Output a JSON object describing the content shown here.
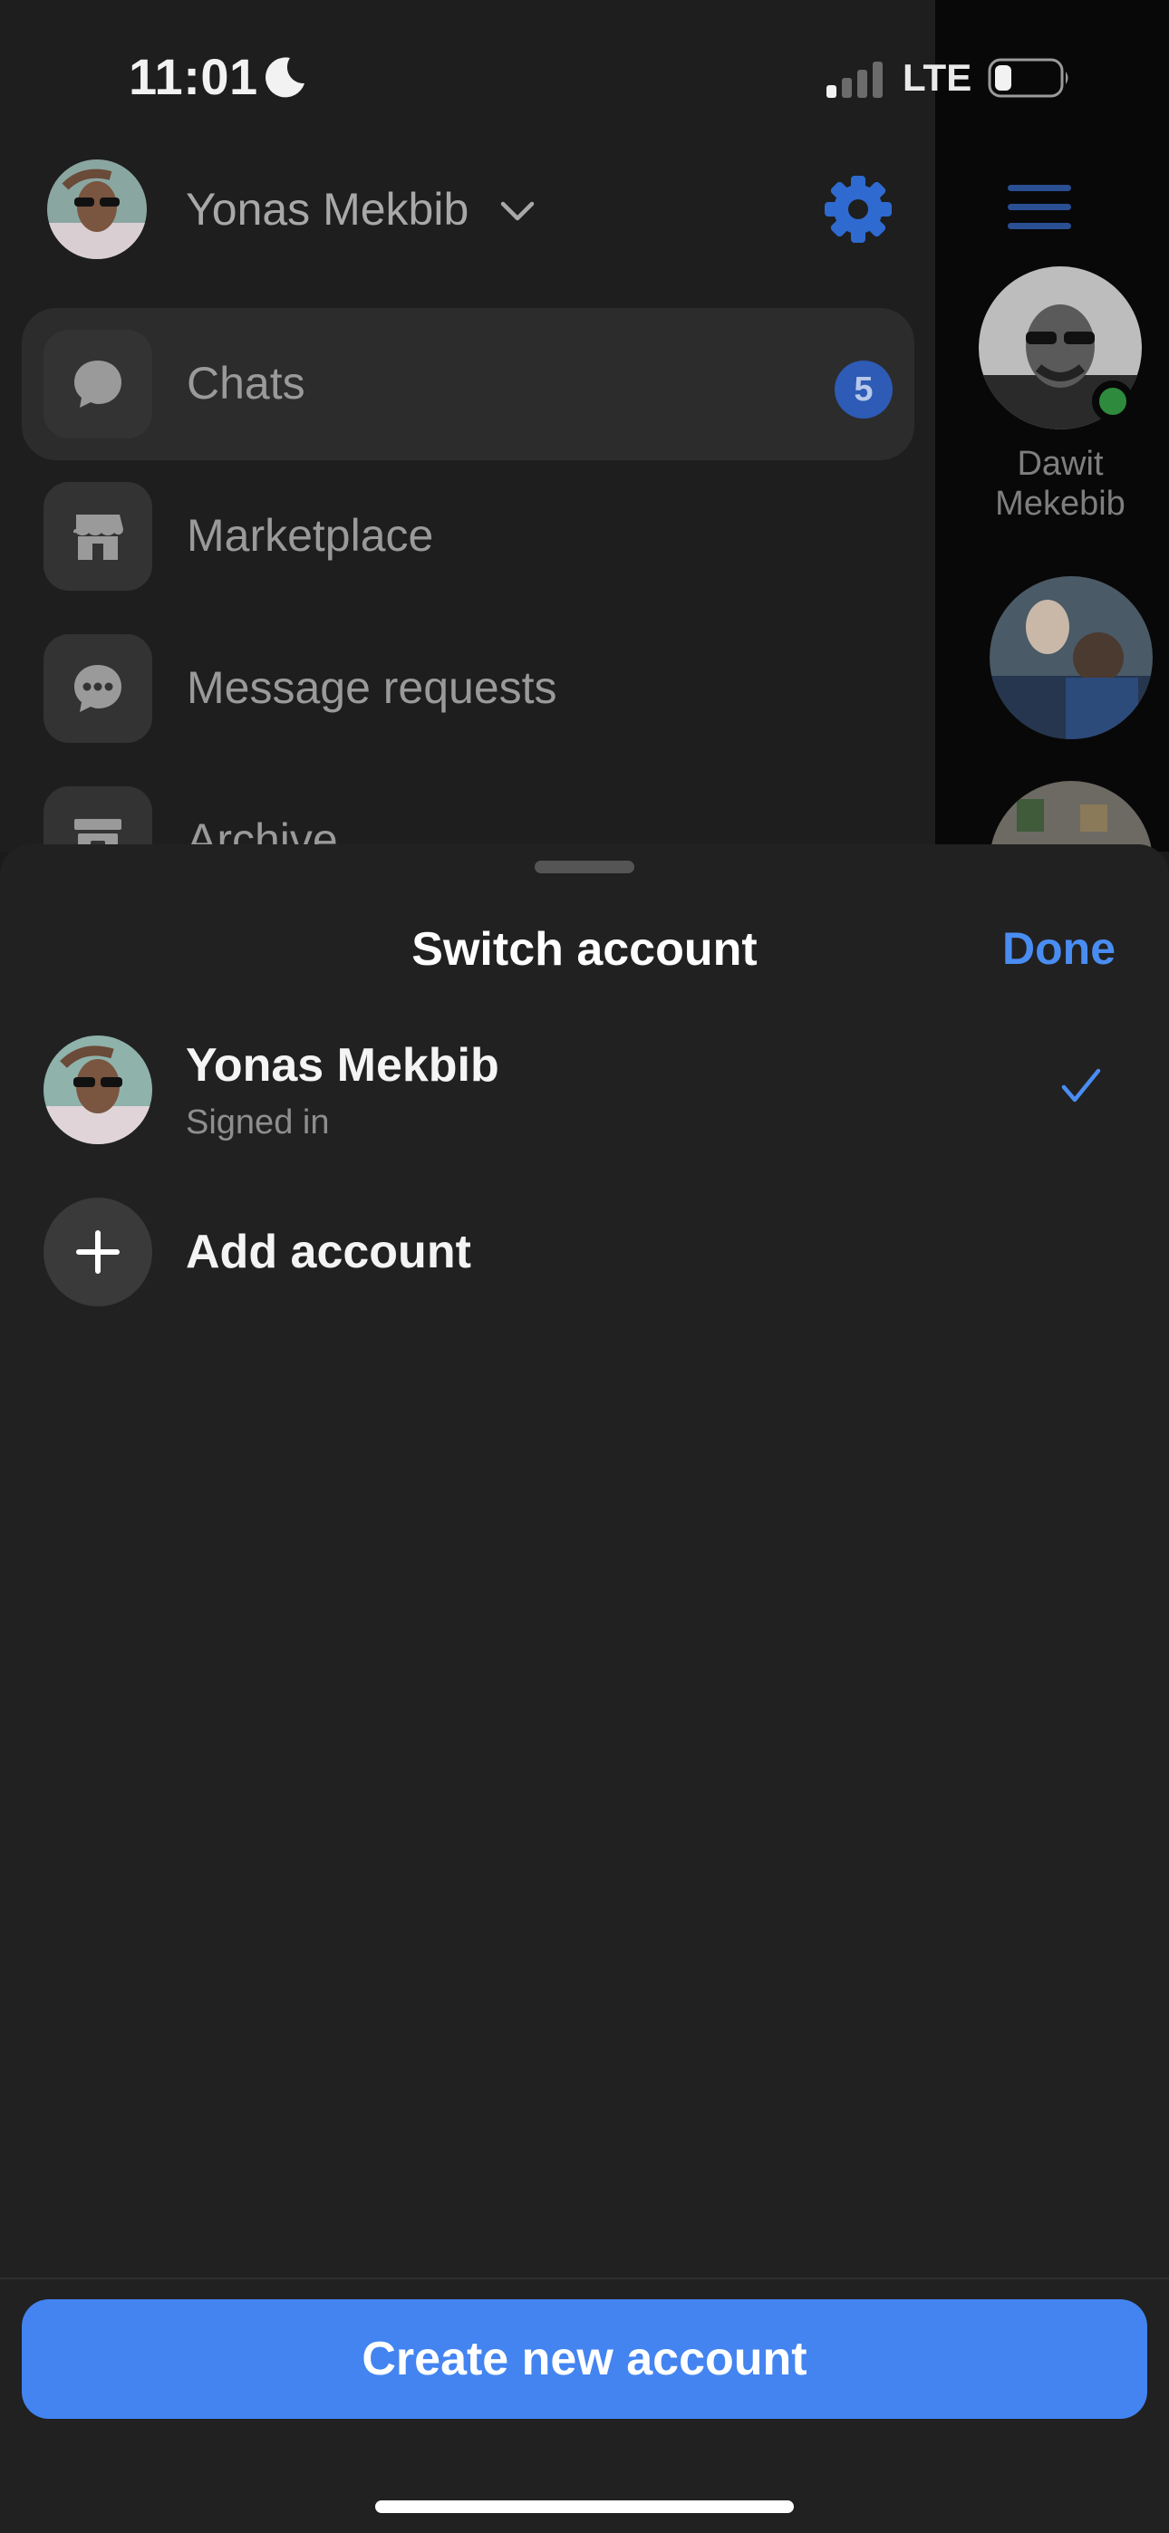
{
  "status_bar": {
    "time": "11:01",
    "network": "LTE",
    "icons": [
      "moon-icon",
      "signal-icon",
      "battery-icon"
    ]
  },
  "drawer": {
    "profile_name": "Yonas Mekbib",
    "icons": [
      "chevron-down-icon",
      "gear-icon",
      "hamburger-icon"
    ],
    "menu": [
      {
        "label": "Chats",
        "icon": "chat-bubble-icon",
        "badge": "5",
        "active": true
      },
      {
        "label": "Marketplace",
        "icon": "store-icon"
      },
      {
        "label": "Message requests",
        "icon": "message-requests-icon"
      },
      {
        "label": "Archive",
        "icon": "archive-icon"
      }
    ]
  },
  "rail": {
    "contacts": [
      {
        "name": "Dawit Mekebib",
        "online": true
      }
    ]
  },
  "sheet": {
    "title": "Switch account",
    "done_label": "Done",
    "accounts": [
      {
        "name": "Yonas Mekbib",
        "status": "Signed in",
        "selected": true
      }
    ],
    "add_account_label": "Add account",
    "create_button_label": "Create new account"
  },
  "colors": {
    "accent": "#4384F1",
    "badge": "#2D5BB5",
    "online": "#2E8B3D",
    "sheet_bg": "#212121"
  }
}
